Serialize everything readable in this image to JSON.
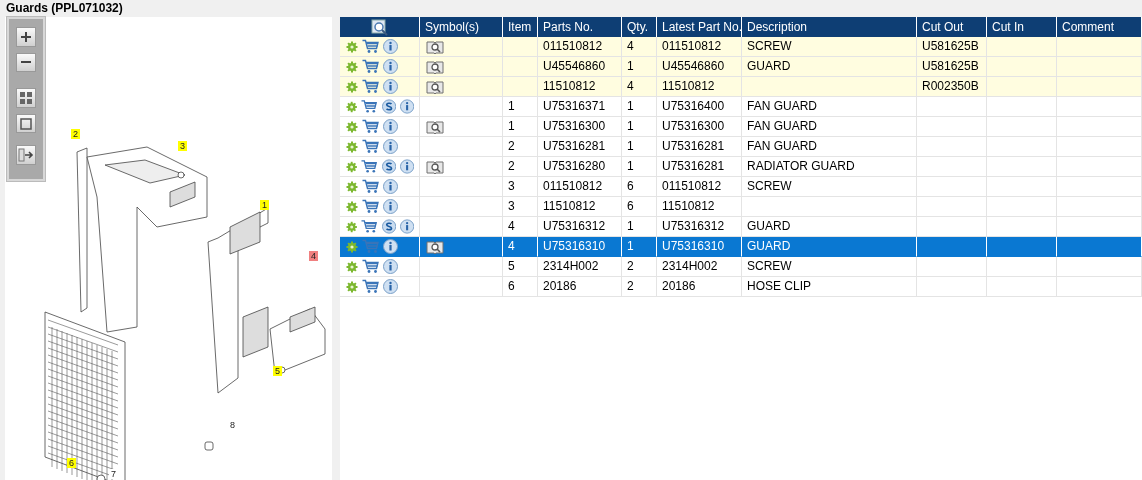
{
  "title": "Guards (PPL071032)",
  "diagram": {
    "callouts": [
      {
        "label": "2",
        "color": "#ffff00"
      },
      {
        "label": "3",
        "color": "#ffff00"
      },
      {
        "label": "1",
        "color": "#ffff00"
      },
      {
        "label": "4",
        "color": "#f08080"
      },
      {
        "label": "5",
        "color": "#ffff00"
      },
      {
        "label": "6",
        "color": "#ffff00"
      },
      {
        "label": "7",
        "color": "#ffffff"
      },
      {
        "label": "8",
        "color": "#ffffff"
      }
    ]
  },
  "table": {
    "columns": [
      "Symbol(s)",
      "Item",
      "Parts No.",
      "Qty.",
      "Latest Part No.",
      "Description",
      "Cut Out",
      "Cut In",
      "Comment"
    ],
    "rows": [
      {
        "tinted": true,
        "selected": false,
        "supersede": false,
        "book": true,
        "item": "",
        "parts_no": "011510812",
        "qty": "4",
        "latest": "011510812",
        "description": "SCREW",
        "cut_out": "U581625B"
      },
      {
        "tinted": true,
        "selected": false,
        "supersede": false,
        "book": true,
        "item": "",
        "parts_no": "U45546860",
        "qty": "1",
        "latest": "U45546860",
        "description": "GUARD",
        "cut_out": "U581625B"
      },
      {
        "tinted": true,
        "selected": false,
        "supersede": false,
        "book": true,
        "item": "",
        "parts_no": "11510812",
        "qty": "4",
        "latest": "11510812",
        "description": "",
        "cut_out": "R002350B"
      },
      {
        "tinted": false,
        "selected": false,
        "supersede": true,
        "book": false,
        "item": "1",
        "parts_no": "U75316371",
        "qty": "1",
        "latest": "U75316400",
        "description": "FAN GUARD",
        "cut_out": ""
      },
      {
        "tinted": false,
        "selected": false,
        "supersede": false,
        "book": true,
        "item": "1",
        "parts_no": "U75316300",
        "qty": "1",
        "latest": "U75316300",
        "description": "FAN GUARD",
        "cut_out": ""
      },
      {
        "tinted": false,
        "selected": false,
        "supersede": false,
        "book": false,
        "item": "2",
        "parts_no": "U75316281",
        "qty": "1",
        "latest": "U75316281",
        "description": "FAN GUARD",
        "cut_out": ""
      },
      {
        "tinted": false,
        "selected": false,
        "supersede": true,
        "book": true,
        "item": "2",
        "parts_no": "U75316280",
        "qty": "1",
        "latest": "U75316281",
        "description": "RADIATOR GUARD",
        "cut_out": ""
      },
      {
        "tinted": false,
        "selected": false,
        "supersede": false,
        "book": false,
        "item": "3",
        "parts_no": "011510812",
        "qty": "6",
        "latest": "011510812",
        "description": "SCREW",
        "cut_out": ""
      },
      {
        "tinted": false,
        "selected": false,
        "supersede": false,
        "book": false,
        "item": "3",
        "parts_no": "11510812",
        "qty": "6",
        "latest": "11510812",
        "description": "",
        "cut_out": ""
      },
      {
        "tinted": false,
        "selected": false,
        "supersede": true,
        "book": false,
        "item": "4",
        "parts_no": "U75316312",
        "qty": "1",
        "latest": "U75316312",
        "description": "GUARD",
        "cut_out": ""
      },
      {
        "tinted": false,
        "selected": true,
        "supersede": false,
        "book": true,
        "item": "4",
        "parts_no": "U75316310",
        "qty": "1",
        "latest": "U75316310",
        "description": "GUARD",
        "cut_out": ""
      },
      {
        "tinted": false,
        "selected": false,
        "supersede": false,
        "book": false,
        "item": "5",
        "parts_no": "2314H002",
        "qty": "2",
        "latest": "2314H002",
        "description": "SCREW",
        "cut_out": ""
      },
      {
        "tinted": false,
        "selected": false,
        "supersede": false,
        "book": false,
        "item": "6",
        "parts_no": "20186",
        "qty": "2",
        "latest": "20186",
        "description": "HOSE CLIP",
        "cut_out": ""
      }
    ]
  }
}
